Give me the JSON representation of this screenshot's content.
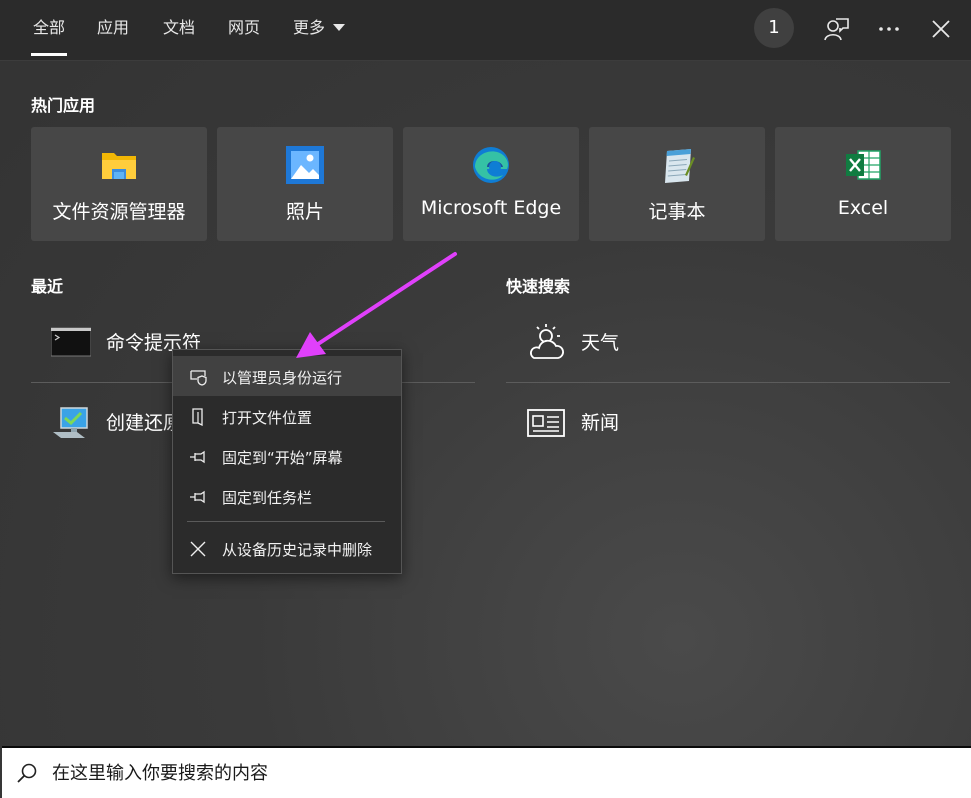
{
  "tabs": [
    {
      "label": "全部",
      "active": true
    },
    {
      "label": "应用"
    },
    {
      "label": "文档"
    },
    {
      "label": "网页"
    },
    {
      "label": "更多"
    }
  ],
  "top_icons": {
    "badge_count": "1",
    "feedback": "feedback-icon",
    "more": "ellipsis-icon",
    "close": "close-icon"
  },
  "hot_apps": {
    "title": "热门应用",
    "items": [
      {
        "label": "文件资源管理器",
        "icon": "folder-icon"
      },
      {
        "label": "照片",
        "icon": "photos-icon"
      },
      {
        "label": "Microsoft Edge",
        "icon": "edge-icon"
      },
      {
        "label": "记事本",
        "icon": "notepad-icon"
      },
      {
        "label": "Excel",
        "icon": "excel-icon"
      }
    ]
  },
  "recent": {
    "title": "最近",
    "items": [
      {
        "label": "命令提示符",
        "icon": "cmd-icon"
      },
      {
        "label": "创建还原点",
        "icon": "computer-icon"
      }
    ]
  },
  "quick_search": {
    "title": "快速搜索",
    "items": [
      {
        "label": "天气",
        "icon": "weather-icon"
      },
      {
        "label": "新闻",
        "icon": "news-icon"
      }
    ]
  },
  "context_menu": {
    "items": [
      {
        "label": "以管理员身份运行",
        "icon": "shield-icon"
      },
      {
        "label": "打开文件位置",
        "icon": "file-location-icon"
      },
      {
        "label": "固定到“开始”屏幕",
        "icon": "pin-icon"
      },
      {
        "label": "固定到任务栏",
        "icon": "pin-icon"
      },
      {
        "label": "从设备历史记录中删除",
        "icon": "close-icon"
      }
    ]
  },
  "search": {
    "placeholder": "在这里输入你要搜索的内容"
  },
  "colors": {
    "accent_arrow": "#e040fb",
    "tile_bg": "#474747",
    "menu_bg": "#2b2b2b"
  }
}
